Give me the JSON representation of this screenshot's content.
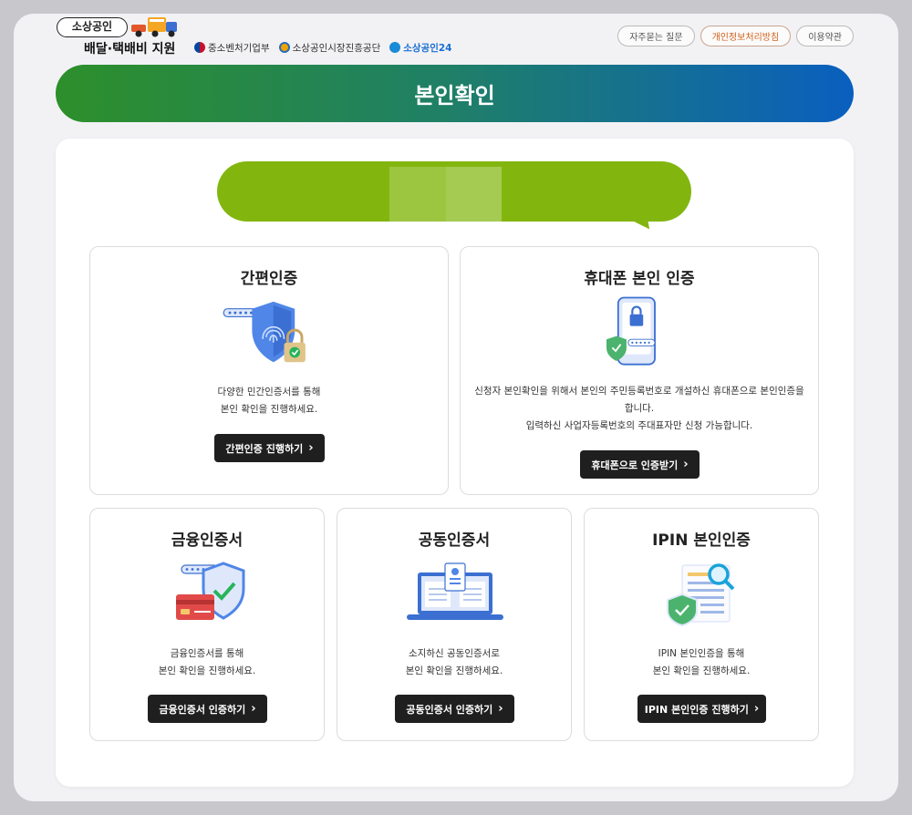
{
  "header": {
    "logo_badge": "소상공인",
    "logo_title": "배달·택배비 지원",
    "agencies": [
      "중소벤처기업부",
      "소상공인시장진흥공단",
      "소상공인24"
    ],
    "links": [
      {
        "label": "자주묻는 질문"
      },
      {
        "label": "개인정보처리방침"
      },
      {
        "label": "이용약관"
      }
    ]
  },
  "banner": {
    "title": "본인확인"
  },
  "cards": {
    "simple": {
      "title": "간편인증",
      "desc": [
        "다양한 민간인증서를 통해",
        "본인 확인을 진행하세요."
      ],
      "button": "간편인증 진행하기"
    },
    "phone": {
      "title": "휴대폰 본인 인증",
      "desc": [
        "신청자 본인확인을 위해서 본인의 주민등록번호로 개설하신 휴대폰으로 본인인증을",
        "합니다.",
        "입력하신 사업자등록번호의 주대표자만 신청 가능합니다."
      ],
      "button": "휴대폰으로 인증받기"
    },
    "finance": {
      "title": "금융인증서",
      "desc": [
        "금융인증서를 통해",
        "본인 확인을 진행하세요."
      ],
      "button": "금융인증서 인증하기"
    },
    "joint": {
      "title": "공동인증서",
      "desc": [
        "소지하신 공동인증서로",
        "본인 확인을 진행하세요."
      ],
      "button": "공동인증서 인증하기"
    },
    "ipin": {
      "title": "IPIN 본인인증",
      "desc": [
        "IPIN 본인인증을 통해",
        "본인 확인을 진행하세요."
      ],
      "button": "IPIN 본인인증 진행하기"
    }
  },
  "colors": {
    "banner_start": "#2d8f2a",
    "banner_end": "#0a5fbf",
    "bubble": "#82b60f",
    "button": "#1f1f1f",
    "accent_link": "#d4601a"
  },
  "icons": {
    "simple": "fingerprint-shield-lock-icon",
    "phone": "phone-lock-icon",
    "finance": "card-shield-icon",
    "joint": "laptop-certificate-icon",
    "ipin": "document-magnifier-icon"
  }
}
